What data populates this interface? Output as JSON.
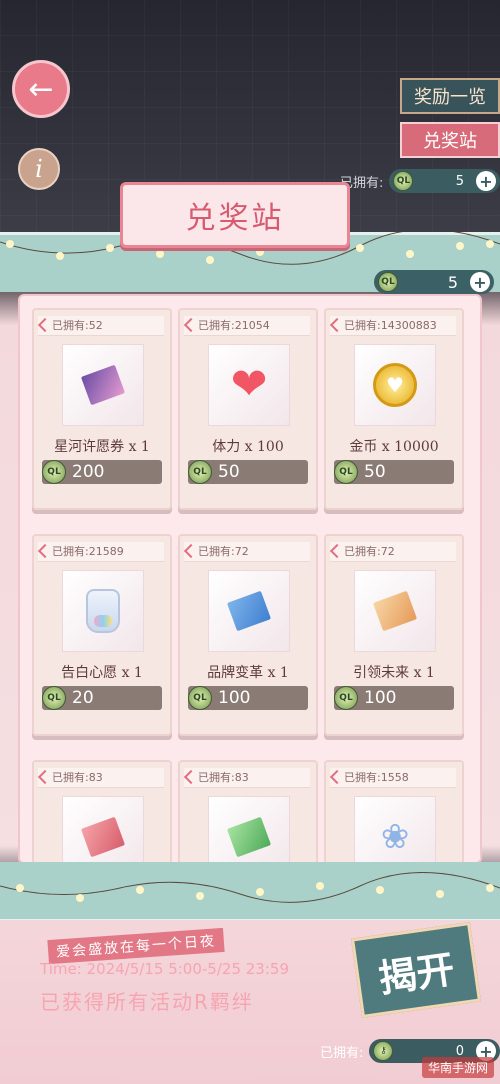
{
  "header": {
    "back_icon": "arrow-left-icon",
    "info_icon": "info-icon",
    "info_glyph": "i",
    "tabs": {
      "rewards": "奖励一览",
      "exchange": "兑奖站"
    },
    "owned_label": "已拥有:",
    "owned_value": "5"
  },
  "store": {
    "title": "兑奖站",
    "currency_value": "5",
    "currency_icon": "ticket-coin-icon",
    "items": [
      {
        "owned": "已拥有:52",
        "name": "星河许愿券 x 1",
        "price": "200"
      },
      {
        "owned": "已拥有:21054",
        "name": "体力 x 100",
        "price": "50"
      },
      {
        "owned": "已拥有:14300883",
        "name": "金币 x 10000",
        "price": "50"
      },
      {
        "owned": "已拥有:21589",
        "name": "告白心愿 x 1",
        "price": "20"
      },
      {
        "owned": "已拥有:72",
        "name": "品牌变革 x 1",
        "price": "100"
      },
      {
        "owned": "已拥有:72",
        "name": "引领未来 x 1",
        "price": "100"
      },
      {
        "owned": "已拥有:83"
      },
      {
        "owned": "已拥有:83"
      },
      {
        "owned": "已拥有:1558"
      }
    ]
  },
  "event": {
    "subtitle": "爱会盛放在每一个日夜",
    "time": "Time: 2024/5/15 5:00-5/25 23:59",
    "status": "已获得所有活动R羁绊",
    "reveal": "揭开"
  },
  "footer": {
    "owned_label": "已拥有:",
    "owned_value": "0",
    "watermark": "华南手游网"
  },
  "colors": {
    "accent": "#e87a8a",
    "teal": "#3b5c60",
    "price_bg": "#8b7b75"
  }
}
